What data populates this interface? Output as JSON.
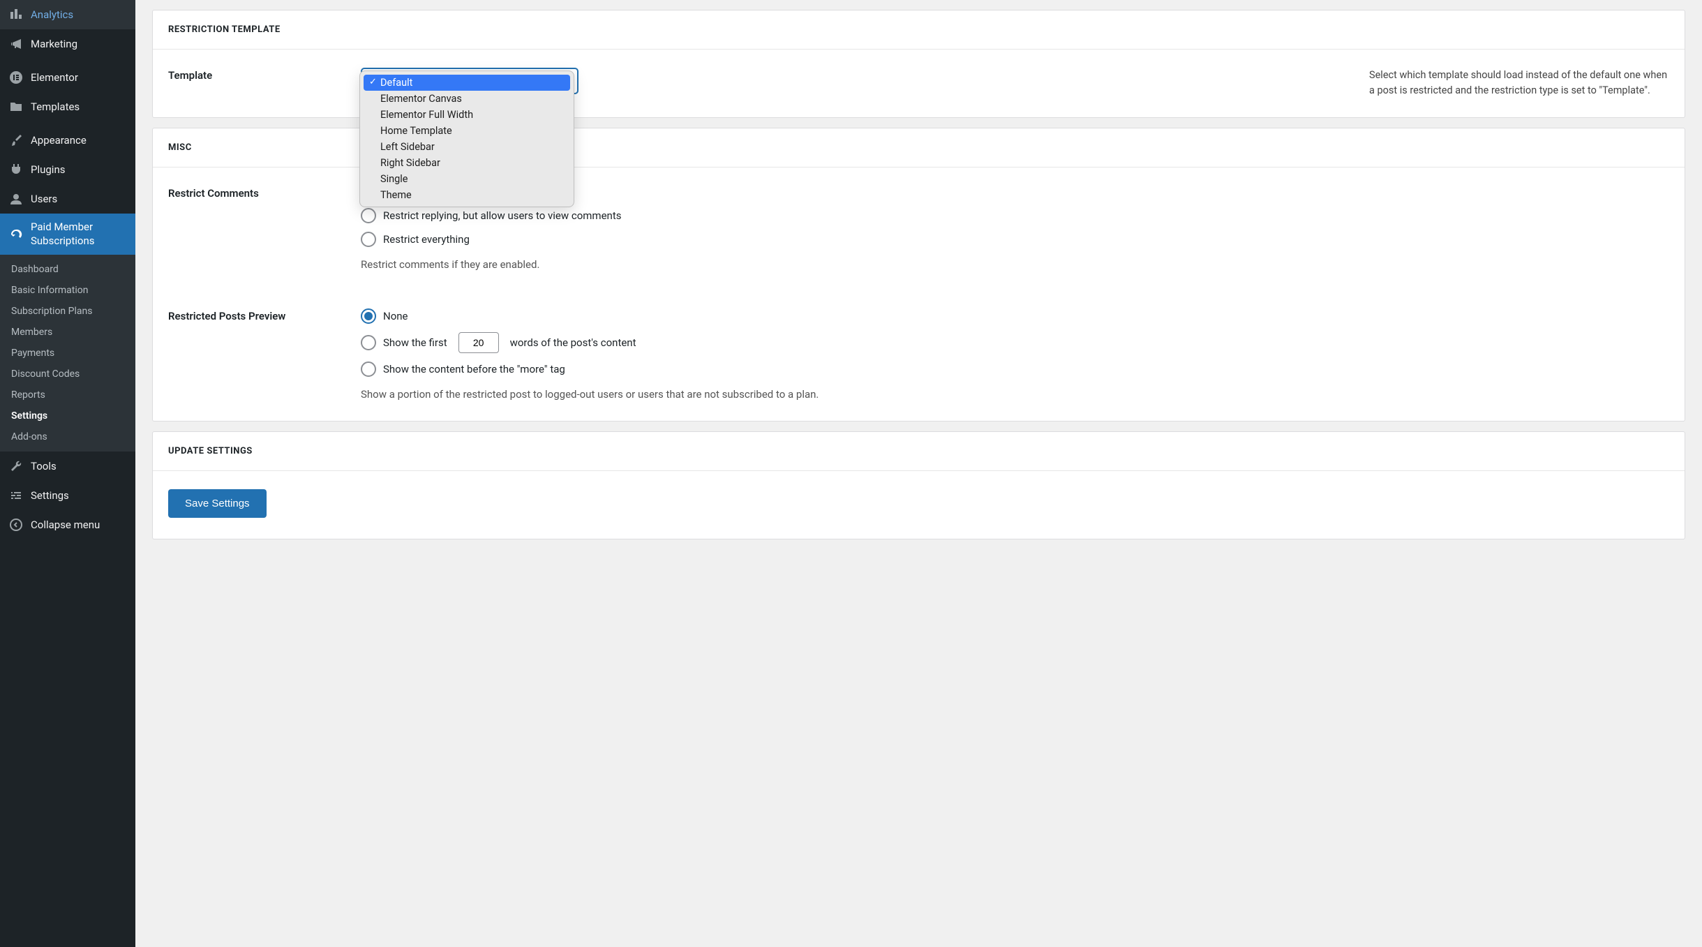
{
  "sidebar": {
    "items": [
      {
        "label": "Analytics"
      },
      {
        "label": "Marketing"
      },
      {
        "label": "Elementor"
      },
      {
        "label": "Templates"
      },
      {
        "label": "Appearance"
      },
      {
        "label": "Plugins"
      },
      {
        "label": "Users"
      },
      {
        "label": "Paid Member Subscriptions"
      },
      {
        "label": "Tools"
      },
      {
        "label": "Settings"
      },
      {
        "label": "Collapse menu"
      }
    ],
    "submenu": [
      {
        "label": "Dashboard"
      },
      {
        "label": "Basic Information"
      },
      {
        "label": "Subscription Plans"
      },
      {
        "label": "Members"
      },
      {
        "label": "Payments"
      },
      {
        "label": "Discount Codes"
      },
      {
        "label": "Reports"
      },
      {
        "label": "Settings"
      },
      {
        "label": "Add-ons"
      }
    ]
  },
  "sections": {
    "restriction_template": {
      "title": "RESTRICTION TEMPLATE",
      "template_label": "Template",
      "template_help": "Select which template should load instead of the default one when a post is restricted and the restriction type is set to \"Template\".",
      "template_selected": "Default",
      "template_options": [
        "Default",
        "Elementor Canvas",
        "Elementor Full Width",
        "Home Template",
        "Left Sidebar",
        "Right Sidebar",
        "Single",
        "Theme"
      ]
    },
    "misc": {
      "title": "MISC",
      "restrict_comments_label": "Restrict Comments",
      "restrict_comments_options": [
        "Restrict replying, but allow users to view comments",
        "Restrict everything"
      ],
      "restrict_comments_desc": "Restrict comments if they are enabled.",
      "restricted_preview_label": "Restricted Posts Preview",
      "preview_none": "None",
      "preview_first_pre": "Show the first",
      "preview_first_post": "words of the post's content",
      "preview_first_value": "20",
      "preview_more": "Show the content before the \"more\" tag",
      "preview_desc": "Show a portion of the restricted post to logged-out users or users that are not subscribed to a plan."
    },
    "update": {
      "title": "UPDATE SETTINGS",
      "save_label": "Save Settings"
    }
  }
}
